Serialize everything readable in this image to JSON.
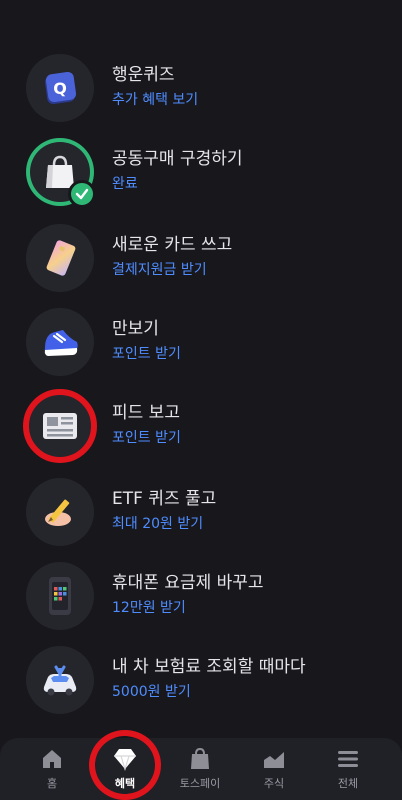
{
  "items": [
    {
      "title": "행운퀴즈",
      "sub": "추가 혜택 보기",
      "icon": "quiz-q-icon"
    },
    {
      "title": "공동구매 구경하기",
      "sub": "완료",
      "icon": "shopping-bag-icon",
      "completed": true
    },
    {
      "title": "새로운 카드 쓰고",
      "sub": "결제지원금 받기",
      "icon": "card-icon"
    },
    {
      "title": "만보기",
      "sub": "포인트 받기",
      "icon": "sneaker-icon"
    },
    {
      "title": "피드 보고",
      "sub": "포인트 받기",
      "icon": "newspaper-icon"
    },
    {
      "title": "ETF 퀴즈 풀고",
      "sub": "최대 20원 받기",
      "icon": "pencil-hand-icon"
    },
    {
      "title": "휴대폰 요금제 바꾸고",
      "sub": "12만원 받기",
      "icon": "phone-icon"
    },
    {
      "title": "내 차 보험료 조회할 때마다",
      "sub": "5000원 받기",
      "icon": "car-icon"
    }
  ],
  "nav": [
    {
      "label": "홈",
      "icon": "home-icon"
    },
    {
      "label": "혜택",
      "icon": "diamond-icon",
      "active": true
    },
    {
      "label": "토스페이",
      "icon": "shopping-bag-icon"
    },
    {
      "label": "주식",
      "icon": "chart-icon"
    },
    {
      "label": "전체",
      "icon": "menu-icon"
    }
  ],
  "colors": {
    "accent": "#4f8dff",
    "success": "#2fb776",
    "highlight": "#e0141c",
    "background": "#17171c"
  }
}
